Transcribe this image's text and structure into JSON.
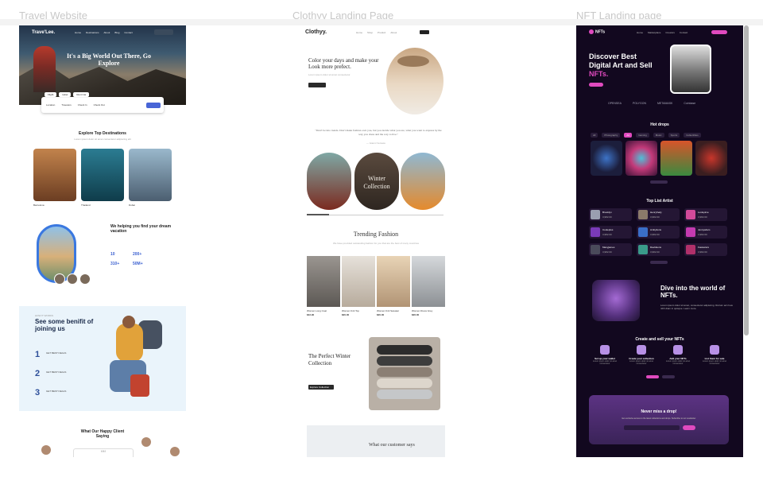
{
  "labels": {
    "travel": "Travel Website",
    "clothing": "Clothyy Landing Page",
    "nft": "NFT Landing page"
  },
  "travel": {
    "logo": "Trave'Lee.",
    "nav": [
      "Home",
      "Destinations",
      "About",
      "Blog",
      "Contact"
    ],
    "headline": "It's a Big World Out There, Go Explore",
    "search_tabs": [
      "Flight",
      "Hotel",
      "Rent Car"
    ],
    "search_fields": [
      "Location",
      "Travelers",
      "Check In",
      "Check Out"
    ],
    "destinations_title": "Explore Top Destinations",
    "destinations_sub": "Lorem ipsum dolor sit amet consectetur adipiscing elit",
    "cards": [
      {
        "name": "Barcelona"
      },
      {
        "name": "Thailand"
      },
      {
        "name": "Dubai"
      }
    ],
    "help_title": "We helping you find your dream vacation",
    "stats": [
      {
        "num": "10"
      },
      {
        "num": "200+"
      },
      {
        "num": "310+"
      },
      {
        "num": "50M+"
      }
    ],
    "benefit_small": "HOW IT WORKS",
    "benefit_title": "See some benifit of joining us",
    "steps": [
      "1",
      "2",
      "3"
    ],
    "step_text": "GET BEST DEALS",
    "testimonial_title": "What Our Happy Client Saying",
    "quote_mark": "““"
  },
  "clothing": {
    "logo": "Clothyy.",
    "nav": [
      "Home",
      "Shop",
      "Product",
      "About"
    ],
    "hero": "Color your days and make your Look more prefect.",
    "hero_sub": "Lorem ipsum dolor sit amet consectetur",
    "quote": "\"Don't be into trends. Don't make fashion own you, but you decide what you are, what you want to express by the way you dress and the way to live.\"",
    "quote_author": "— Gianni Versace",
    "winter": "Winter Collection",
    "trending": "Trending Fashion",
    "trending_sub": "We have provided outstanding fashion for you that are the best of many countries",
    "products": [
      {
        "name": "Women Long Coat",
        "price": "$42.90"
      },
      {
        "name": "Women Knit Top",
        "price": "$20.00"
      },
      {
        "name": "Women Knit Sweater",
        "price": "$20.00"
      },
      {
        "name": "Women Dress Grey",
        "price": "$26.00"
      }
    ],
    "perfect": "The Perfect Winter Collection",
    "perfect_btn": "Explore Collection",
    "customer": "What our customer says"
  },
  "nft": {
    "logo": "NFTs",
    "nav": [
      "Home",
      "Marketplace",
      "Creators",
      "Contact"
    ],
    "hero_a": "Discover Best Digital Art and Sell ",
    "hero_b": "NFTs.",
    "partners": [
      "OPENSEA",
      "POLYGON",
      "METAMASK",
      "Coinbase"
    ],
    "hot_title": "Hot drops",
    "filters": [
      "All",
      "Photography",
      "Art",
      "Gaming",
      "Music",
      "Sports",
      "Collectibles"
    ],
    "artist_title": "Top List Artist",
    "artists": [
      "Brooklyn",
      "Henryfredy",
      "Luxlupime",
      "Cooleplus",
      "Ambytions",
      "Jennysdam",
      "Manyjames",
      "Davidsons",
      "Fastestors"
    ],
    "artist_val": "3,982.00",
    "dive": "Dive into the world of NFTs.",
    "dive_text": "Lorem ipsum dolor sit amet, consectetur adipiscing. Rutrum aci risus nibh diam in quisque. Learn more.",
    "create_title": "Create and sell your NFTs",
    "steps": [
      "Set up your wallet",
      "Create your collection",
      "Add your NFTs",
      "List them for sale"
    ],
    "step_text": "Lorem ipsum dolor sit amet consectetur",
    "news_title": "Never miss a drop!",
    "news_sub": "Get exclusive access to the latest collections and drops. Subscribe to our newsletter."
  },
  "colors": {
    "accent_blue": "#4865d6",
    "nft_pink": "#e04abf",
    "nft_bg": "#12081f"
  }
}
